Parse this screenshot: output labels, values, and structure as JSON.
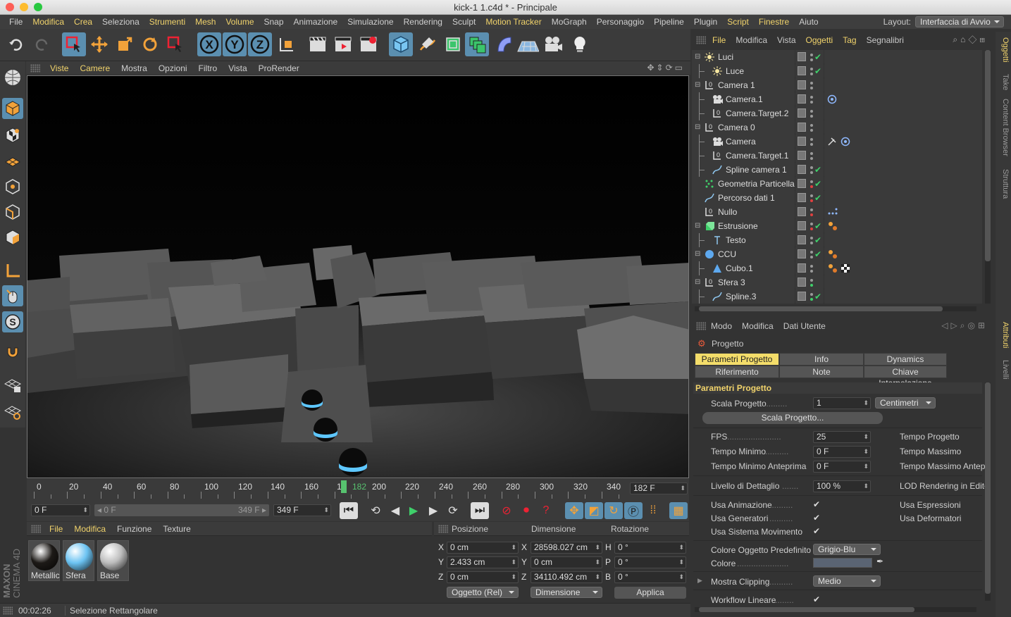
{
  "window": {
    "title": "kick-1 1.c4d * - Principale"
  },
  "menu": {
    "items": [
      "File",
      "Modifica",
      "Crea",
      "Seleziona",
      "Strumenti",
      "Mesh",
      "Volume",
      "Snap",
      "Animazione",
      "Simulazione",
      "Rendering",
      "Sculpt",
      "Motion Tracker",
      "MoGraph",
      "Personaggio",
      "Pipeline",
      "Plugin",
      "Script",
      "Finestre",
      "Aiuto"
    ],
    "layout_label": "Layout:",
    "layout_value": "Interfaccia di Avvio"
  },
  "viewport_menu": [
    "Viste",
    "Camere",
    "Mostra",
    "Opzioni",
    "Filtro",
    "Vista",
    "ProRender"
  ],
  "timeline": {
    "ticks": [
      "0",
      "20",
      "40",
      "60",
      "80",
      "100",
      "120",
      "140",
      "160",
      "18",
      "182",
      "200",
      "220",
      "240",
      "260",
      "280",
      "300",
      "320",
      "340"
    ],
    "current_frame_display": "182 F",
    "start_field": "0 F",
    "range_start": "◂ 0 F",
    "range_end": "349 F ▸",
    "end_field": "349 F"
  },
  "materials": {
    "menu": [
      "File",
      "Modifica",
      "Funzione",
      "Texture"
    ],
    "items": [
      {
        "name": "Metallic",
        "color": "#1d1a17"
      },
      {
        "name": "Sfera",
        "color": "#6cc3f2"
      },
      {
        "name": "Base",
        "color": "#bdbdbd"
      }
    ]
  },
  "coords": {
    "headers": [
      "Posizione",
      "Dimensione",
      "Rotazione"
    ],
    "rows": [
      {
        "axis": "X",
        "pos": "0 cm",
        "dim_axis": "X",
        "dim": "28598.027 cm",
        "rot_axis": "H",
        "rot": "0 °"
      },
      {
        "axis": "Y",
        "pos": "2.433 cm",
        "dim_axis": "Y",
        "dim": "0 cm",
        "rot_axis": "P",
        "rot": "0 °"
      },
      {
        "axis": "Z",
        "pos": "0 cm",
        "dim_axis": "Z",
        "dim": "34110.492 cm",
        "rot_axis": "B",
        "rot": "0 °"
      }
    ],
    "mode_select": "Oggetto (Rel)",
    "dim_select": "Dimensione",
    "apply_label": "Applica"
  },
  "status": {
    "time": "00:02:26",
    "message": "Selezione Rettangolare"
  },
  "objects_menu": [
    "File",
    "Modifica",
    "Vista",
    "Oggetti",
    "Tag",
    "Segnalibri"
  ],
  "objects": [
    {
      "name": "Luci",
      "indent": 0,
      "icon": "light-icon",
      "dot2": "#9a9a9a",
      "check": true,
      "tag": ""
    },
    {
      "name": "Luce",
      "indent": 1,
      "icon": "light-icon",
      "dot2": "#9a9a9a",
      "check": true,
      "tag": ""
    },
    {
      "name": "Camera 1",
      "indent": 0,
      "icon": "null-icon",
      "dot2": "#9a9a9a",
      "check": false,
      "tag": ""
    },
    {
      "name": "Camera.1",
      "indent": 1,
      "icon": "camera-icon",
      "dot2": "#9a9a9a",
      "check": false,
      "tag": "target"
    },
    {
      "name": "Camera.Target.2",
      "indent": 1,
      "icon": "null-icon",
      "dot2": "#9a9a9a",
      "check": false,
      "tag": ""
    },
    {
      "name": "Camera 0",
      "indent": 0,
      "icon": "null-icon",
      "dot2": "#9a9a9a",
      "check": false,
      "tag": ""
    },
    {
      "name": "Camera",
      "indent": 1,
      "icon": "camera-icon",
      "dot2": "#9a9a9a",
      "check": false,
      "tag": "camtarget"
    },
    {
      "name": "Camera.Target.1",
      "indent": 1,
      "icon": "null-icon",
      "dot2": "#9a9a9a",
      "check": false,
      "tag": ""
    },
    {
      "name": "Spline camera 1",
      "indent": 1,
      "icon": "spline-icon",
      "dot2": "#9a9a9a",
      "check": true,
      "tag": ""
    },
    {
      "name": "Geometria Particella",
      "indent": 0,
      "icon": "particle-icon",
      "dot2": "#e04040",
      "check": true,
      "tag": ""
    },
    {
      "name": "Percorso dati 1",
      "indent": 0,
      "icon": "spline-icon",
      "dot2": "#e04040",
      "check": true,
      "tag": ""
    },
    {
      "name": "Nullo",
      "indent": 0,
      "icon": "null-icon",
      "dot2": "#e04040",
      "check": false,
      "tag": "dots"
    },
    {
      "name": "Estrusione",
      "indent": 0,
      "icon": "extrude-icon",
      "dot2": "#e04040",
      "check": true,
      "tag": "material"
    },
    {
      "name": "Testo",
      "indent": 1,
      "icon": "text-icon",
      "dot2": "#9a9a9a",
      "check": true,
      "tag": ""
    },
    {
      "name": "CCU",
      "indent": 0,
      "icon": "sphere-icon",
      "dot2": "#9a9a9a",
      "check": true,
      "tag": "material"
    },
    {
      "name": "Cubo.1",
      "indent": 1,
      "icon": "cone-icon",
      "dot2": "#9a9a9a",
      "check": false,
      "tag": "material-checker"
    },
    {
      "name": "Sfera 3",
      "indent": 0,
      "icon": "null-icon",
      "dot2": "#3fcf6a",
      "check": false,
      "tag": ""
    },
    {
      "name": "Spline.3",
      "indent": 1,
      "icon": "spline-icon",
      "dot2": "#3fcf6a",
      "check": true,
      "tag": ""
    }
  ],
  "attributes": {
    "menu": [
      "Modo",
      "Modifica",
      "Dati Utente"
    ],
    "title": "Progetto",
    "tabs": [
      "Parametri Progetto",
      "Info",
      "Dynamics",
      "Riferimento",
      "Note",
      "Chiave Interpolazione"
    ],
    "section_title": "Parametri Progetto",
    "scale_label": "Scala Progetto",
    "scale_value": "1",
    "scale_unit": "Centimetri",
    "scale_button": "Scala Progetto...",
    "fps_label": "FPS",
    "fps_value": "25",
    "min_time_label": "Tempo Minimo",
    "min_time_value": "0 F",
    "min_preview_label": "Tempo Minimo Anteprima",
    "min_preview_value": "0 F",
    "project_time_label": "Tempo Progetto",
    "max_time_label": "Tempo Massimo",
    "max_preview_label": "Tempo Massimo Antep",
    "lod_label": "Livello di Dettaglio",
    "lod_value": "100 %",
    "lod_render_label": "LOD Rendering in Edito",
    "use_animation": "Usa Animazione",
    "use_generators": "Usa Generatori",
    "use_motion": "Usa Sistema Movimento",
    "use_expressions": "Usa Espressioni",
    "use_deformers": "Usa Deformatori",
    "default_color_label": "Colore Oggetto Predefinito",
    "default_color_value": "Grigio-Blu",
    "color_label": "Colore",
    "color_swatch": "#5a6473",
    "clipping_label": "Mostra Clipping",
    "clipping_value": "Medio",
    "linear_workflow": "Workflow Lineare"
  },
  "side_tabs": [
    "Oggetti",
    "Take",
    "Content Browser",
    "Struttura",
    "Attributi",
    "Livelli"
  ],
  "brand": "MAXON CINEMA 4D"
}
